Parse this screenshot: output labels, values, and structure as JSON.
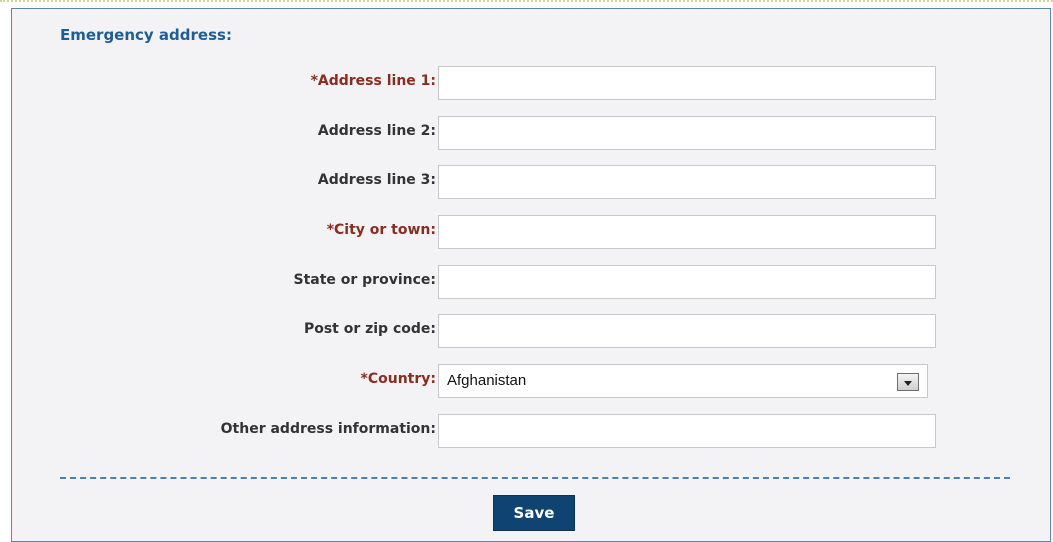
{
  "section": {
    "title": "Emergency address:"
  },
  "fields": [
    {
      "label": "*Address line 1:",
      "value": ""
    },
    {
      "label": "Address line 2:",
      "value": ""
    },
    {
      "label": "Address line 3:",
      "value": ""
    },
    {
      "label": "*City or town:",
      "value": ""
    },
    {
      "label": "State or province:",
      "value": ""
    },
    {
      "label": "Post or zip code:",
      "value": ""
    }
  ],
  "country": {
    "label": "*Country:",
    "selected": "Afghanistan"
  },
  "other": {
    "label": "Other address information:",
    "value": ""
  },
  "save_label": "Save",
  "colors": {
    "panel_bg": "#f3f2f5",
    "panel_border": "#5b86b2",
    "title": "#1f5d96",
    "required_label": "#8a2c1f",
    "label": "#333333",
    "button_bg": "#0f4472"
  },
  "icons": {
    "dropdown": "chevron-down-icon"
  }
}
